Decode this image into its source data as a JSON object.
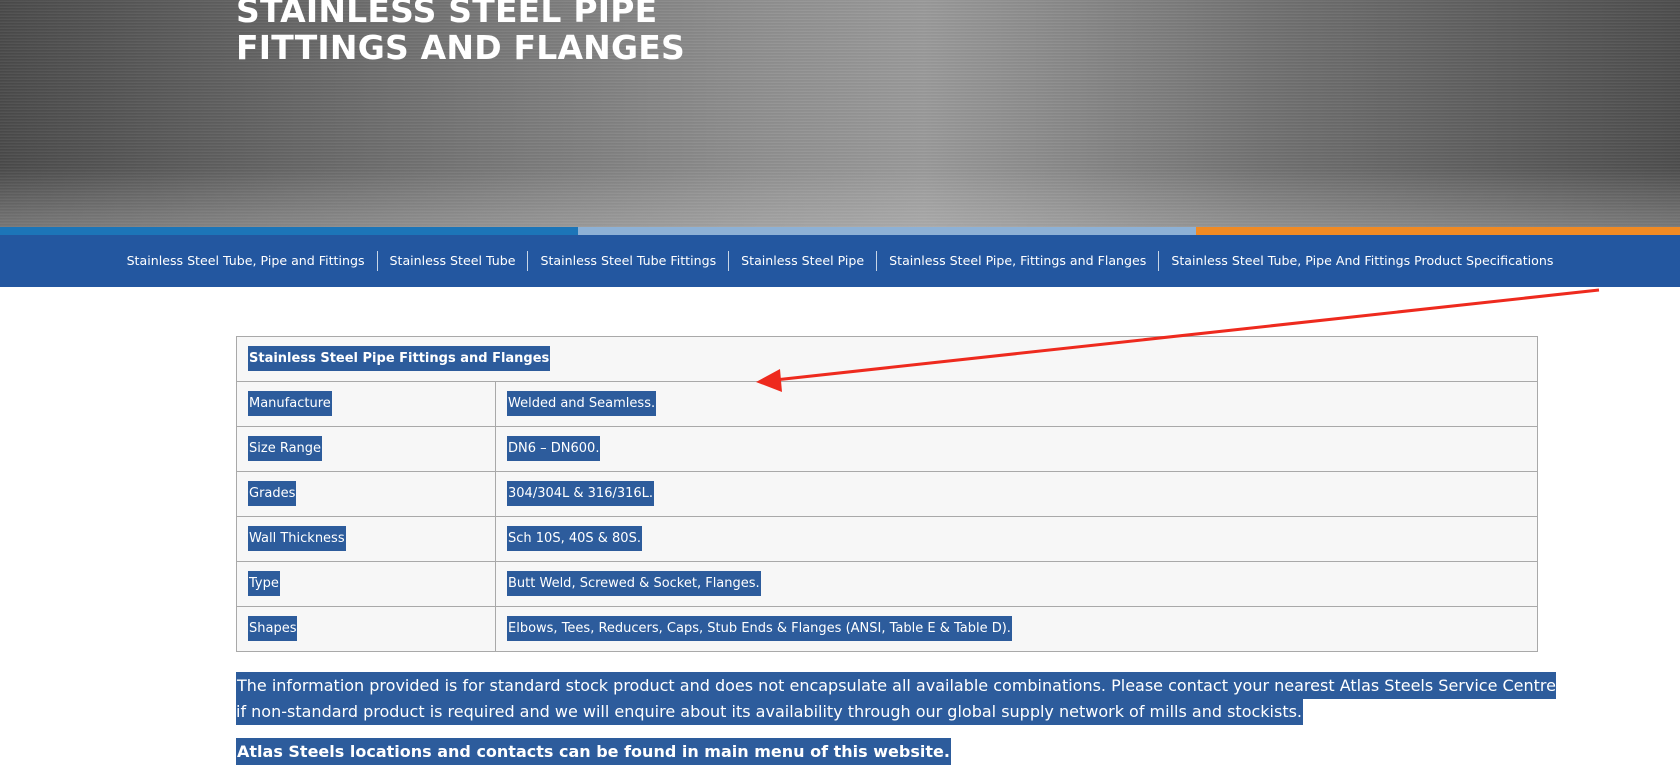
{
  "hero": {
    "title": "STAINLESS STEEL PIPE FITTINGS AND FLANGES"
  },
  "colors": {
    "stripe_1": "#1c75b8",
    "stripe_2": "#8db1d6",
    "stripe_3": "#f08a24",
    "nav_bg": "#2357a0",
    "arrow": "#ee2a1e",
    "highlight": "#2d5c9c"
  },
  "nav": {
    "items": [
      "Stainless Steel Tube, Pipe and Fittings",
      "Stainless Steel Tube",
      "Stainless Steel Tube Fittings",
      "Stainless Steel Pipe",
      "Stainless Steel Pipe, Fittings and Flanges",
      "Stainless Steel Tube, Pipe And Fittings Product Specifications"
    ]
  },
  "table": {
    "header": "Stainless Steel Pipe Fittings and Flanges",
    "rows": [
      [
        "Manufacture",
        "Welded and Seamless."
      ],
      [
        "Size Range",
        "DN6 – DN600."
      ],
      [
        "Grades",
        "304/304L & 316/316L."
      ],
      [
        "Wall Thickness",
        "Sch 10S, 40S & 80S."
      ],
      [
        "Type",
        "Butt Weld, Screwed & Socket, Flanges."
      ],
      [
        "Shapes",
        "Elbows, Tees, Reducers, Caps, Stub Ends & Flanges (ANSI, Table E & Table D)."
      ]
    ]
  },
  "notes": {
    "info": "The information provided is for standard stock product and does not encapsulate all available combinations. Please contact your nearest Atlas Steels Service Centre if non-standard product is required and we will enquire about its availability through our global supply network of mills and stockists.",
    "locations": "Atlas Steels locations and contacts can be found in main menu of this website."
  }
}
